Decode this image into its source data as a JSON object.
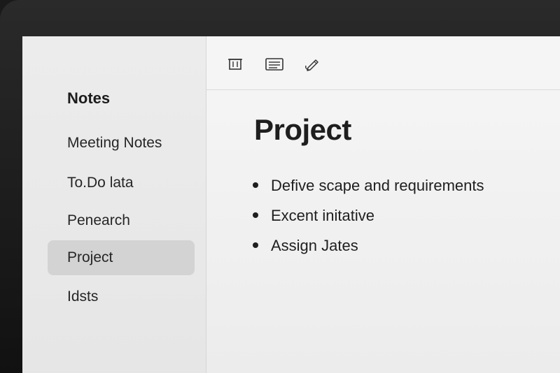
{
  "sidebar": {
    "title": "Notes",
    "items": [
      {
        "label": "Meeting Notes",
        "selected": false
      },
      {
        "label": "To.Do lata",
        "selected": false
      },
      {
        "label": "Penearch",
        "selected": false
      },
      {
        "label": "Project",
        "selected": true
      },
      {
        "label": "Idsts",
        "selected": false
      }
    ]
  },
  "toolbar": {
    "buttons": [
      {
        "icon": "trash-icon"
      },
      {
        "icon": "list-icon"
      },
      {
        "icon": "pen-icon"
      }
    ]
  },
  "document": {
    "title": "Project",
    "bullets": [
      "Defive scape and requirements",
      "Excent initative",
      "Assign Jates"
    ]
  }
}
